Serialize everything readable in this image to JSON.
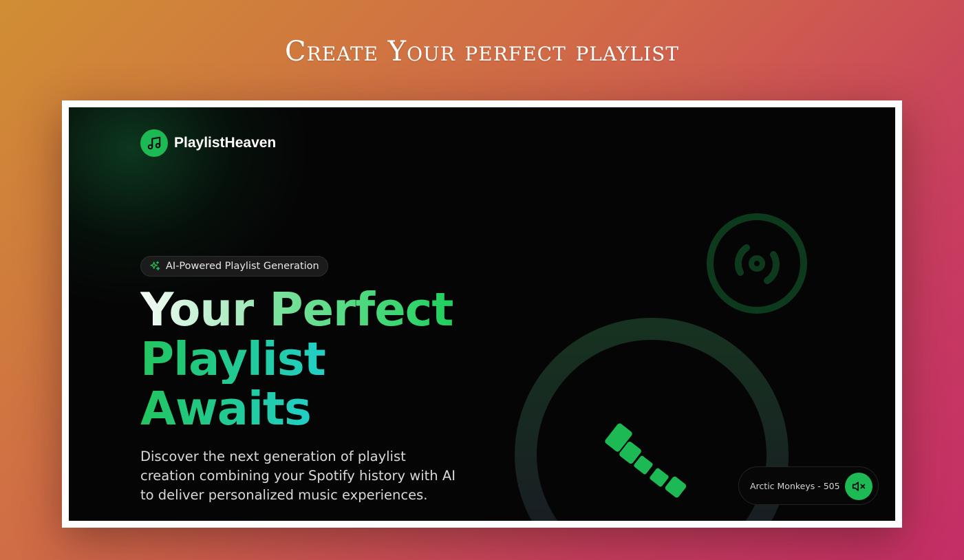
{
  "page": {
    "heading": "Create Your perfect playlist"
  },
  "brand": {
    "name": "PlaylistHeaven",
    "logo_icon": "music-note-icon",
    "accent": "#1db954"
  },
  "hero": {
    "badge_label": "AI-Powered Playlist Generation",
    "badge_icon": "sparkles-icon",
    "title_words": [
      "Your",
      "Perfect",
      "Playlist",
      "Awaits"
    ],
    "description": "Discover the next generation of playlist creation combining your Spotify history with AI to deliver personalized music experiences."
  },
  "decorations": {
    "vinyl_icon": "disc-icon",
    "ring": "record-ring",
    "equalizer": "equalizer-bars"
  },
  "player": {
    "track_label": "Arctic Monkeys - 505",
    "mute_icon": "volume-mute-icon",
    "state": "muted"
  },
  "colors": {
    "background": "#050505",
    "accent_green": "#1db954",
    "accent_teal": "#22cfc6",
    "text_light": "#d9d9d9"
  }
}
